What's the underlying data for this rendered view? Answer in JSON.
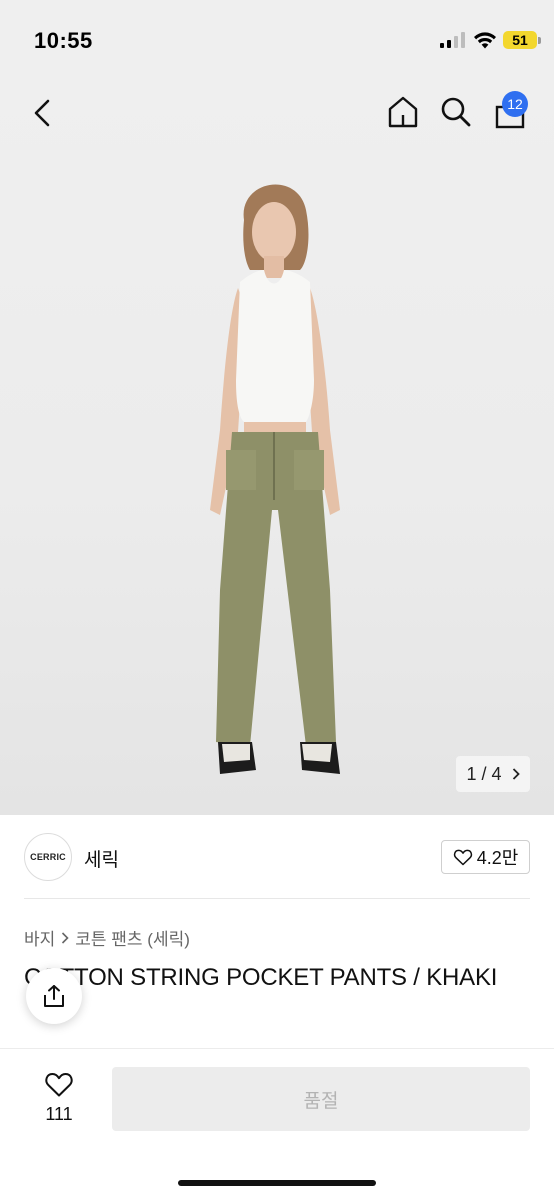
{
  "status_bar": {
    "time": "10:55",
    "battery": "51"
  },
  "header": {
    "cart_count": "12"
  },
  "gallery": {
    "current": "1",
    "separator": "/",
    "total": "4"
  },
  "brand": {
    "logo_text": "CERRIC",
    "name": "세릭",
    "likes": "4.2만"
  },
  "breadcrumb": {
    "category": "바지",
    "subcategory": "코튼 팬츠 (세릭)"
  },
  "product": {
    "title": "COTTON STRING POCKET PANTS / KHAKI"
  },
  "bottom_bar": {
    "wish_count": "111",
    "buy_label": "품절"
  },
  "colors": {
    "badge": "#2f6ff0",
    "battery": "#f3d72e",
    "pants": "#8e9068"
  },
  "icons": [
    "back-arrow-icon",
    "home-icon",
    "search-icon",
    "cart-icon",
    "chevron-right-icon",
    "heart-icon",
    "share-icon",
    "wifi-icon",
    "signal-icon",
    "battery-icon"
  ]
}
